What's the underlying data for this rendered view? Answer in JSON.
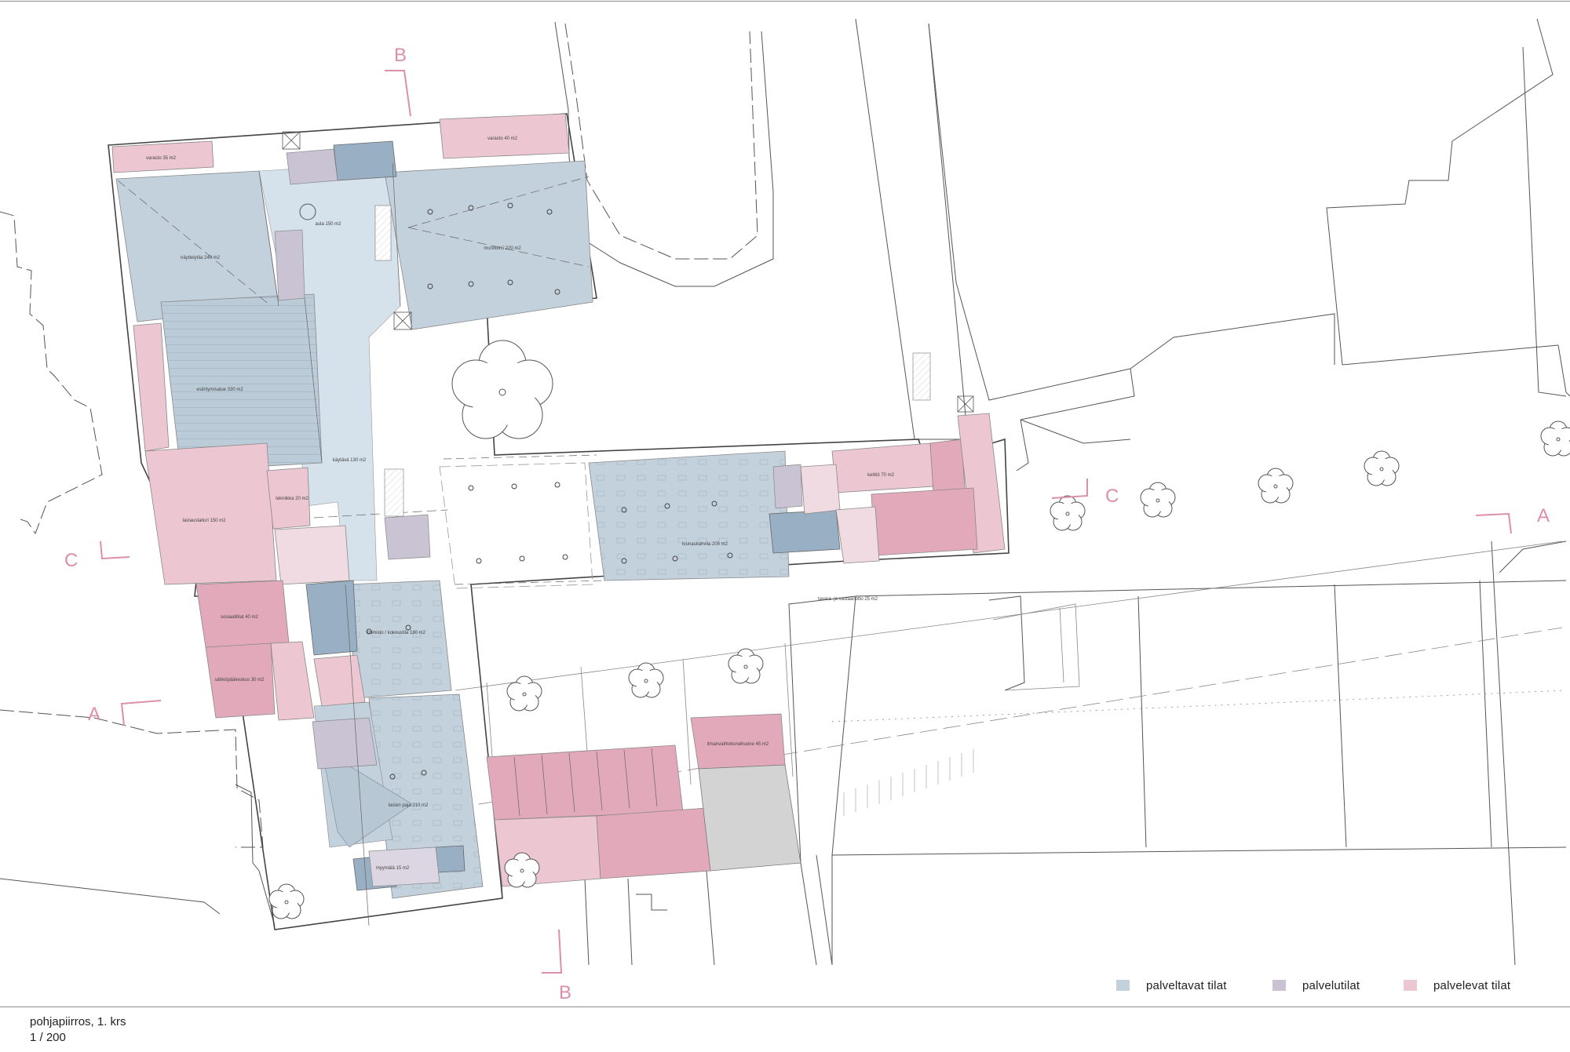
{
  "drawing": {
    "title": "pohjapiirros, 1. krs",
    "scale": "1 / 200"
  },
  "colors": {
    "served": "#c3d1dd",
    "service": "#c9c3d3",
    "serving": "#ecc6d1",
    "section_marker": "#dd8fa8",
    "lines": "#555555",
    "grey_block": "#d3d3d3"
  },
  "legend": [
    {
      "label": "palveltavat tilat",
      "color": "#c3d1dd"
    },
    {
      "label": "palvelutilat",
      "color": "#c9c3d3"
    },
    {
      "label": "palvelevat tilat",
      "color": "#ecc6d1"
    }
  ],
  "section_markers": {
    "b_top": "B",
    "b_bottom": "B",
    "c_left": "C",
    "c_right": "C",
    "a_left": "A",
    "a_right": "A"
  },
  "room_labels": [
    {
      "text": "varasto 35 m2",
      "category": "serving"
    },
    {
      "text": "varasto 40 m2",
      "category": "serving"
    },
    {
      "text": "näyttelytila 240 m2",
      "category": "served"
    },
    {
      "text": "aula 150 m2",
      "category": "served"
    },
    {
      "text": "monitoimi 220 m2",
      "category": "served"
    },
    {
      "text": "esiintymisalue 330 m2",
      "category": "served"
    },
    {
      "text": "käytävä 130 m2",
      "category": "served"
    },
    {
      "text": "lounaskahvila 205 m2",
      "category": "served"
    },
    {
      "text": "toimisto / kokoustila 180 m2",
      "category": "served"
    },
    {
      "text": "lasten paja 210 m2",
      "category": "served"
    },
    {
      "text": "lastauslaituri 150 m2",
      "category": "serving"
    },
    {
      "text": "keittiö 70 m2",
      "category": "serving"
    },
    {
      "text": "tekniikka 20 m2",
      "category": "serving"
    },
    {
      "text": "sosiaalitilat 40 m2",
      "category": "serving"
    },
    {
      "text": "sähköpääkeskus 30 m2",
      "category": "serving"
    },
    {
      "text": "tavara- ja vastaanotto 25 m2",
      "category": "serving"
    },
    {
      "text": "ilmanvaihtokonehuone 45 m2",
      "category": "serving"
    },
    {
      "text": "myymälä 15 m2",
      "category": "service"
    }
  ]
}
